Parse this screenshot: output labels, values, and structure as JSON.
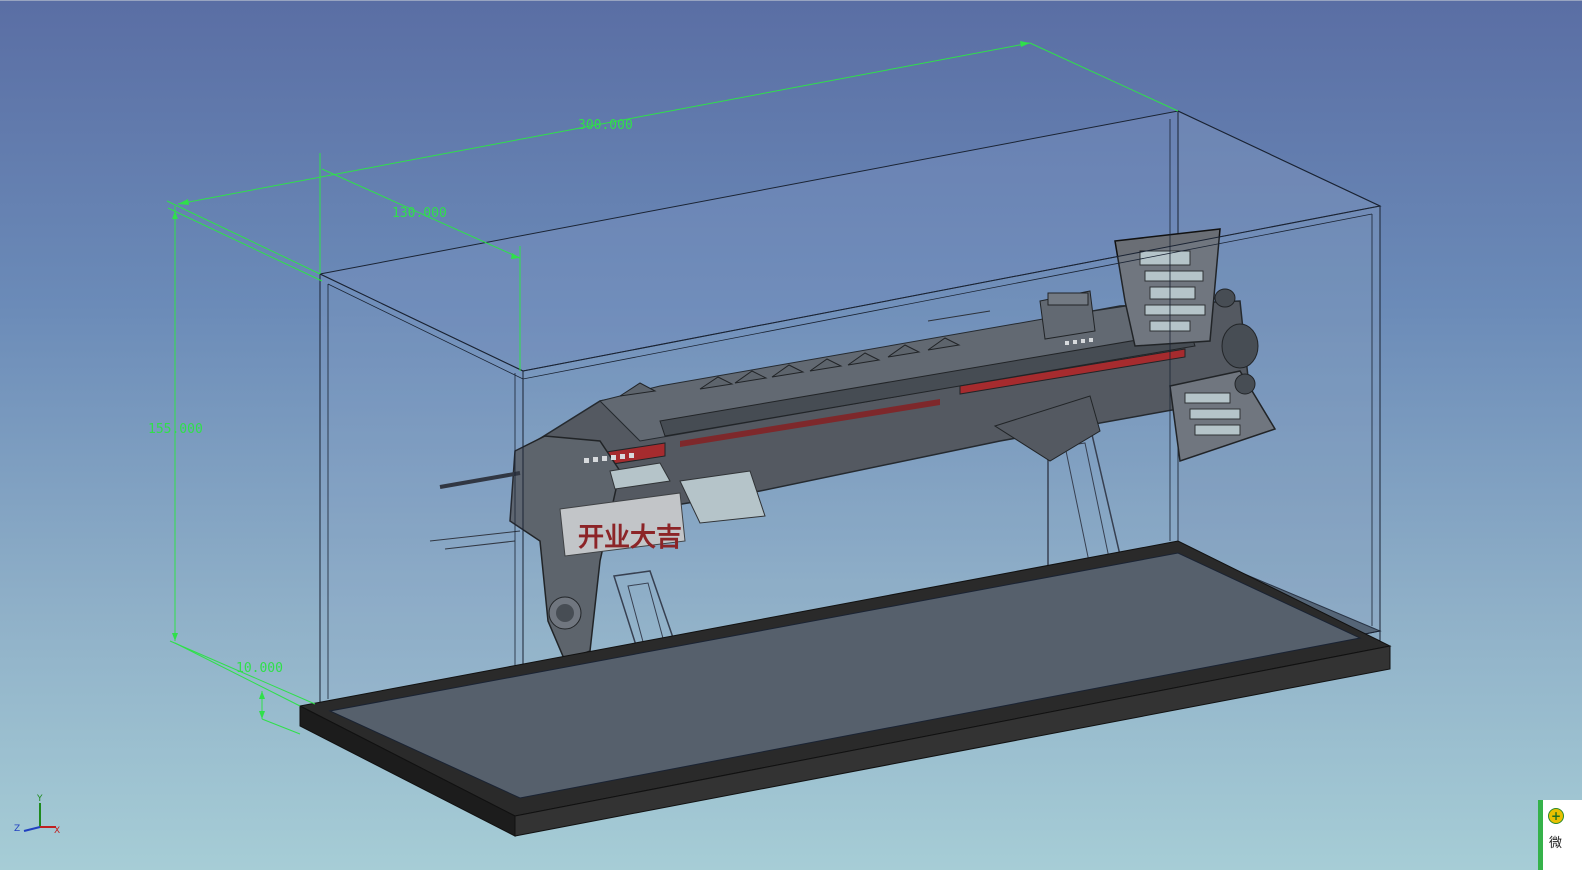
{
  "dimensions": {
    "length": "300.000",
    "depth": "130.000",
    "height": "155.000",
    "base": "10.000"
  },
  "model": {
    "banner_text": "开业大吉"
  },
  "axes": {
    "x": "X",
    "y": "Y",
    "z": "Z"
  },
  "notification": {
    "icon": "plus-icon",
    "text": "微"
  },
  "colors": {
    "dimension_line": "#2fe04a",
    "background_top": "#5a6ea4",
    "background_bottom": "#a6cdd6",
    "banner_red": "#8a1010"
  }
}
